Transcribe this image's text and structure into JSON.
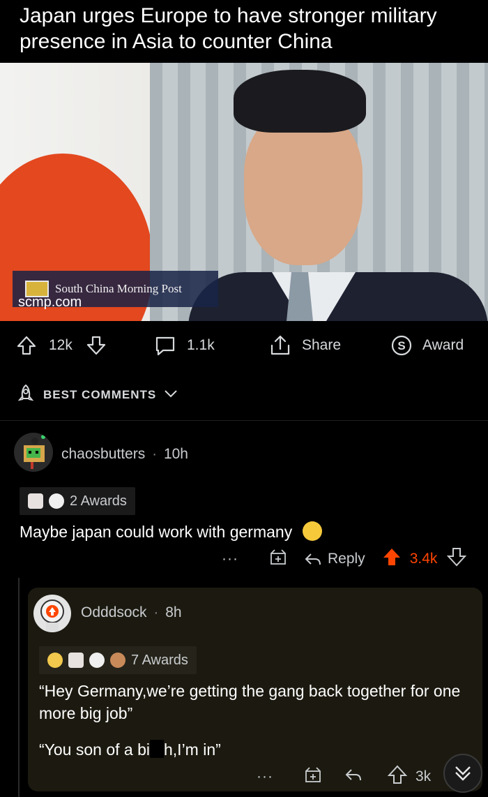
{
  "post": {
    "title": "Japan urges Europe to have stronger military presence in Asia to counter China",
    "source_name": "South China Morning Post",
    "source_domain": "scmp.com"
  },
  "post_actions": {
    "upvotes": "12k",
    "comments": "1.1k",
    "share_label": "Share",
    "award_label": "Award"
  },
  "sort": {
    "label": "BEST COMMENTS"
  },
  "comments": [
    {
      "username": "chaosbutters",
      "sep": "·",
      "age": "10h",
      "awards_label": "2 Awards",
      "text": "Maybe japan could work with germany",
      "more": "···",
      "reply_label": "Reply",
      "score": "3.4k"
    },
    {
      "username": "Odddsock",
      "sep": "·",
      "age": "8h",
      "awards_label": "7 Awards",
      "text_line1": "“Hey Germany,we’re getting the gang back together for one more big job”",
      "text_line2_a": "“You son of a bi",
      "text_line2_b": "h,I’m in”",
      "more": "···",
      "score": "3k"
    }
  ],
  "colors": {
    "upvote_orange": "#ff4500",
    "reply_card_bg": "#1c1a10"
  }
}
